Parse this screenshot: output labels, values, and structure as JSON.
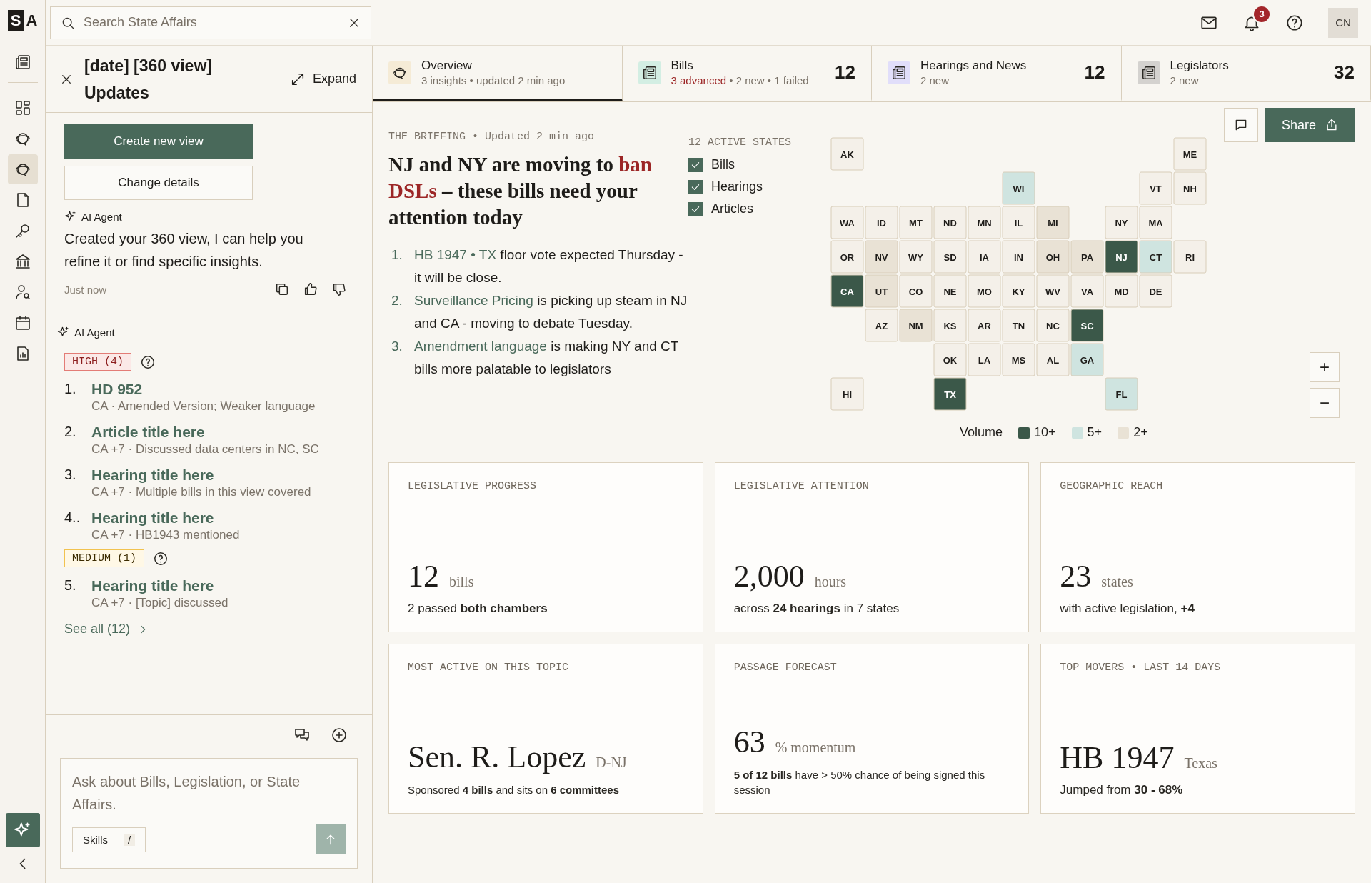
{
  "brand": {
    "logo_letters": [
      "S",
      "A"
    ]
  },
  "rail": {
    "items": [
      {
        "selected": false
      },
      {
        "selected": false
      },
      {
        "selected": false
      },
      {
        "selected": true
      },
      {
        "selected": false
      },
      {
        "selected": false
      },
      {
        "selected": false
      },
      {
        "selected": false
      },
      {
        "selected": false
      },
      {
        "selected": false
      }
    ]
  },
  "search": {
    "placeholder": "Search State Affairs"
  },
  "header_actions": {
    "notification_count": "3",
    "avatar": "CN"
  },
  "panel": {
    "title": "[date] [360 view] Updates",
    "expand": "Expand",
    "buttons": [
      {
        "label": "Create new view",
        "kind": "primary"
      },
      {
        "label": "Change details",
        "kind": "secondary"
      }
    ],
    "message": {
      "author": "AI Agent",
      "text": "Created your 360 view, I can help you refine it or find specific insights.",
      "time": "Just now"
    },
    "insights_author": "AI Agent",
    "groups": [
      {
        "badge": "HIGH (4)",
        "kind": "high",
        "items": [
          {
            "number": "1.",
            "title": "HD 952",
            "meta": "CA · Amended Version; Weaker language"
          },
          {
            "number": "2.",
            "title": "Article title here",
            "meta": "CA +7 · Discussed data centers in NC, SC"
          },
          {
            "number": "3.",
            "title": "Hearing title here",
            "meta": "CA +7 · Multiple bills in this view covered"
          },
          {
            "number": "4..",
            "title": "Hearing title here",
            "meta": "CA +7 · HB1943 mentioned"
          }
        ]
      },
      {
        "badge": "MEDIUM (1)",
        "kind": "medium",
        "items": [
          {
            "number": "5.",
            "title": "Hearing title here",
            "meta": "CA +7 · [Topic] discussed"
          }
        ]
      }
    ],
    "see_all": "See all (12)",
    "composer": {
      "placeholder": "Ask about Bills, Legislation, or State Affairs.",
      "skills": "Skills",
      "shortcut": "/"
    }
  },
  "tabs": [
    {
      "label": "Overview",
      "selected": true,
      "subtitle": "3 insights • updated 2 min ago"
    },
    {
      "label": "Bills",
      "selected": false,
      "alert": "3 advanced",
      "subtitle": "• 2 new • 1 failed",
      "count": "12"
    },
    {
      "label": "Hearings and News",
      "selected": false,
      "subtitle": "2 new",
      "count": "12"
    },
    {
      "label": "Legislators",
      "selected": false,
      "subtitle": "2 new",
      "count": "32"
    }
  ],
  "briefing": {
    "eyebrow": "THE BRIEFING • Updated 2 min ago",
    "headline": [
      {
        "text": "NJ and NY are moving to ",
        "emphasis": false
      },
      {
        "text": "ban DSLs",
        "emphasis": true
      },
      {
        "text": " – these bills need your attention today",
        "emphasis": false
      }
    ],
    "items": [
      {
        "number": "1.",
        "link": "HB 1947 • TX",
        "text": " floor vote expected Thursday - it will be close."
      },
      {
        "number": "2.",
        "link": "Surveillance Pricing",
        "text": " is picking up steam in NJ and CA - moving to debate Tuesday."
      },
      {
        "number": "3.",
        "link": "Amendment language",
        "text": " is making NY and CT bills more palatable to legislators"
      }
    ]
  },
  "map": {
    "title": "12 ACTIVE STATES",
    "layers": [
      {
        "label": "Bills",
        "checked": true
      },
      {
        "label": "Hearings",
        "checked": true
      },
      {
        "label": "Articles",
        "checked": true
      }
    ],
    "share": "Share",
    "zoom_in": "+",
    "zoom_out": "−",
    "legend_title": "Volume",
    "legend": [
      {
        "label": "10+",
        "color": "#3b5849"
      },
      {
        "label": "5+",
        "color": "#cfe4e0"
      },
      {
        "label": "2+",
        "color": "#e9e2d5"
      }
    ],
    "states": [
      {
        "code": "AK",
        "color": "#f4f0e9"
      },
      {
        "code": "ME",
        "color": "#f4f0e9"
      },
      {
        "code": "WI",
        "color": "#cfe4e0"
      },
      {
        "code": "VT",
        "color": "#f4f0e9"
      },
      {
        "code": "NH",
        "color": "#f4f0e9"
      },
      {
        "code": "WA",
        "color": "#f4f0e9"
      },
      {
        "code": "ID",
        "color": "#f4f0e9"
      },
      {
        "code": "MT",
        "color": "#f4f0e9"
      },
      {
        "code": "ND",
        "color": "#f4f0e9"
      },
      {
        "code": "MN",
        "color": "#f4f0e9"
      },
      {
        "code": "IL",
        "color": "#f4f0e9"
      },
      {
        "code": "MI",
        "color": "#e9e2d5"
      },
      {
        "code": "NY",
        "color": "#f4f0e9"
      },
      {
        "code": "MA",
        "color": "#f4f0e9"
      },
      {
        "code": "OR",
        "color": "#f4f0e9"
      },
      {
        "code": "NV",
        "color": "#e9e2d5"
      },
      {
        "code": "WY",
        "color": "#f4f0e9"
      },
      {
        "code": "SD",
        "color": "#f4f0e9"
      },
      {
        "code": "IA",
        "color": "#f4f0e9"
      },
      {
        "code": "IN",
        "color": "#f4f0e9"
      },
      {
        "code": "OH",
        "color": "#e9e2d5"
      },
      {
        "code": "PA",
        "color": "#e9e2d5"
      },
      {
        "code": "NJ",
        "color": "#3b5849"
      },
      {
        "code": "CT",
        "color": "#cfe4e0"
      },
      {
        "code": "RI",
        "color": "#f4f0e9"
      },
      {
        "code": "CA",
        "color": "#3b5849"
      },
      {
        "code": "UT",
        "color": "#e9e2d5"
      },
      {
        "code": "CO",
        "color": "#f4f0e9"
      },
      {
        "code": "NE",
        "color": "#f4f0e9"
      },
      {
        "code": "MO",
        "color": "#f4f0e9"
      },
      {
        "code": "KY",
        "color": "#f4f0e9"
      },
      {
        "code": "WV",
        "color": "#f4f0e9"
      },
      {
        "code": "VA",
        "color": "#f4f0e9"
      },
      {
        "code": "MD",
        "color": "#f4f0e9"
      },
      {
        "code": "DE",
        "color": "#f4f0e9"
      },
      {
        "code": "AZ",
        "color": "#f4f0e9"
      },
      {
        "code": "NM",
        "color": "#e9e2d5"
      },
      {
        "code": "KS",
        "color": "#f4f0e9"
      },
      {
        "code": "AR",
        "color": "#f4f0e9"
      },
      {
        "code": "TN",
        "color": "#f4f0e9"
      },
      {
        "code": "NC",
        "color": "#f4f0e9"
      },
      {
        "code": "SC",
        "color": "#3b5849"
      },
      {
        "code": "OK",
        "color": "#f4f0e9"
      },
      {
        "code": "LA",
        "color": "#f4f0e9"
      },
      {
        "code": "MS",
        "color": "#f4f0e9"
      },
      {
        "code": "AL",
        "color": "#f4f0e9"
      },
      {
        "code": "GA",
        "color": "#cfe4e0"
      },
      {
        "code": "HI",
        "color": "#f4f0e9"
      },
      {
        "code": "TX",
        "color": "#3b5849"
      },
      {
        "code": "FL",
        "color": "#cfe4e0"
      }
    ]
  },
  "cards": [
    {
      "label": "LEGISLATIVE PROGRESS",
      "value": "12",
      "unit": "bills",
      "note": "2 passed **both chambers**"
    },
    {
      "label": "LEGISLATIVE ATTENTION",
      "value": "2,000",
      "unit": "hours",
      "note": "across **24 hearings** in 7 states"
    },
    {
      "label": "GEOGRAPHIC REACH",
      "value": "23",
      "unit": "states",
      "note": "with active legislation, **+4**"
    },
    {
      "label": "MOST ACTIVE ON THIS TOPIC",
      "value": "Sen. R. Lopez",
      "unit": "D-NJ",
      "note": "Sponsored **4 bills** and sits on **6 committees**",
      "kind": "small"
    },
    {
      "label": "PASSAGE FORECAST",
      "value": "63",
      "unit": "% momentum",
      "note": "**5 of 12 bills** have > 50% chance of being signed this session",
      "kind": "small"
    },
    {
      "label": "TOP MOVERS • LAST 14 DAYS",
      "value": "HB 1947",
      "unit": "Texas",
      "note": "Jumped from **30 - 68%**",
      "kind": "normal"
    }
  ]
}
